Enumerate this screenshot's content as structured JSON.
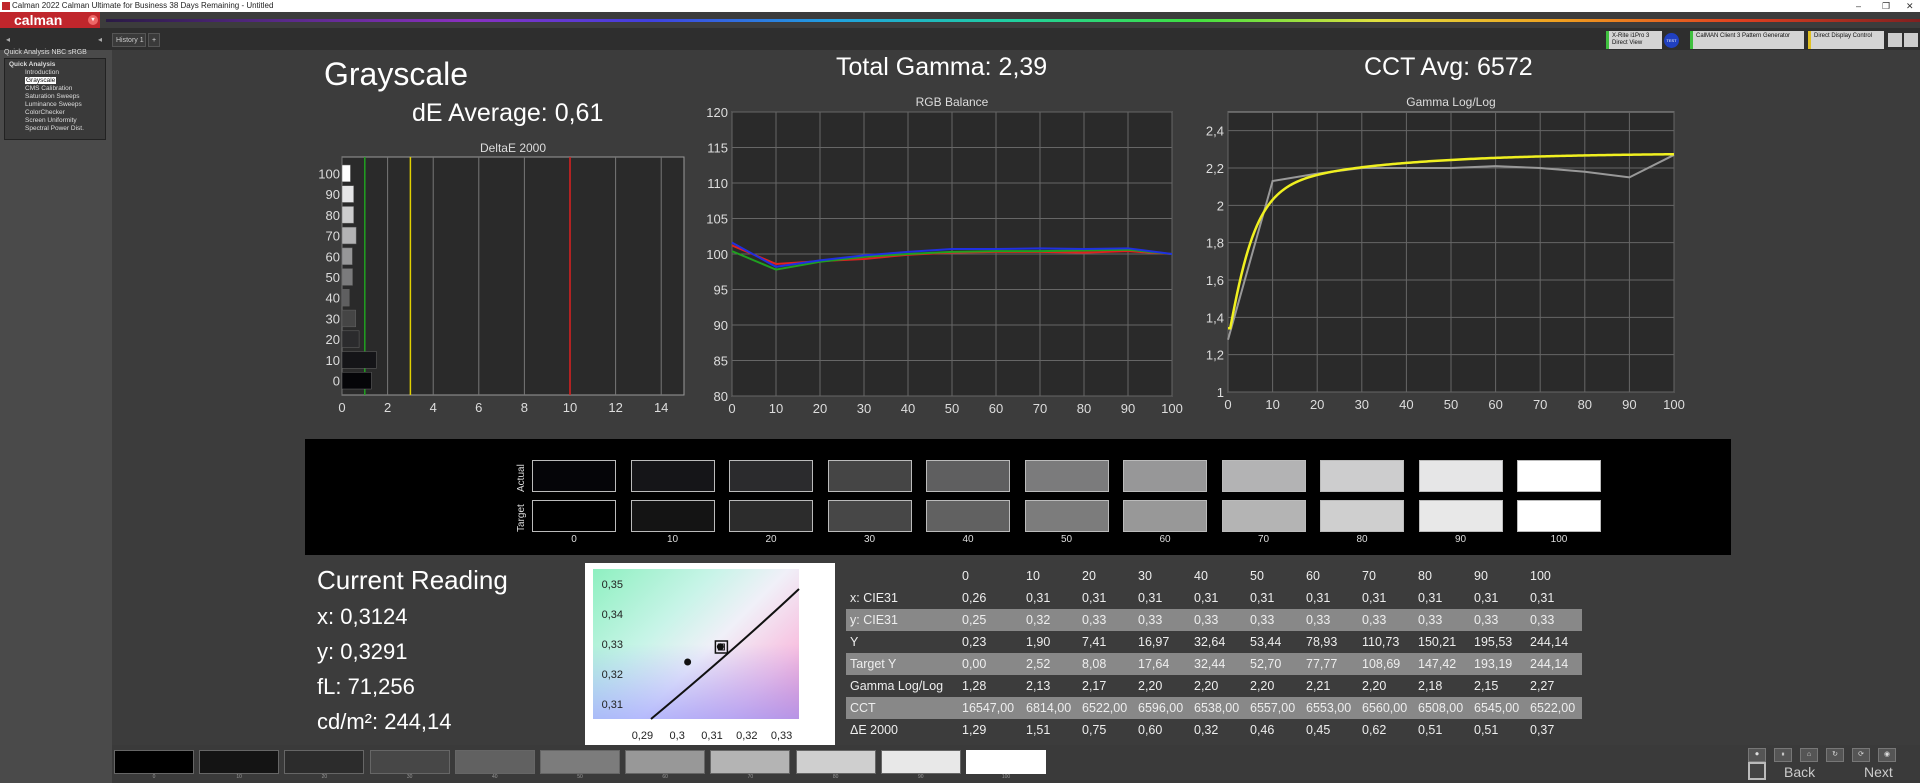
{
  "window": {
    "title": "Calman 2022 Calman Ultimate for Business 38 Days Remaining  - Untitled",
    "minimize": "–",
    "maximize": "❐",
    "close": "✕"
  },
  "brand": {
    "logo_text": "calman",
    "menu_glyph": "▾"
  },
  "tab": {
    "label": "History 1",
    "add": "+"
  },
  "devices": [
    {
      "line1": "X-Rite i1Pro 3",
      "line2": "Direct View",
      "accent": "#40c040"
    },
    {
      "line1": "CalMAN Client 3 Pattern Generator",
      "line2": "",
      "accent": "#40c040"
    },
    {
      "line1": "Direct Display Control",
      "line2": "",
      "accent": "#e0c020"
    }
  ],
  "device_badge": "TEST",
  "sidebar": {
    "title": "Quick Analysis NBC sRGB",
    "items": [
      {
        "label": "Quick Analysis",
        "selected": false,
        "level": 0
      },
      {
        "label": "Introduction",
        "selected": false,
        "level": 1
      },
      {
        "label": "Grayscale",
        "selected": true,
        "level": 1
      },
      {
        "label": "CMS Calibration",
        "selected": false,
        "level": 1
      },
      {
        "label": "Saturation Sweeps",
        "selected": false,
        "level": 1
      },
      {
        "label": "Luminance Sweeps",
        "selected": false,
        "level": 1
      },
      {
        "label": "ColorChecker",
        "selected": false,
        "level": 1
      },
      {
        "label": "Screen Uniformity",
        "selected": false,
        "level": 1
      },
      {
        "label": "Spectral Power Dist.",
        "selected": false,
        "level": 1
      }
    ]
  },
  "header": {
    "page_title": "Grayscale",
    "de_average": "dE Average: 0,61",
    "total_gamma": "Total Gamma: 2,39",
    "cct_avg": "CCT Avg: 6572"
  },
  "chart_data": [
    {
      "type": "bar",
      "title": "DeltaE 2000",
      "orientation": "horizontal",
      "categories": [
        "0",
        "10",
        "20",
        "30",
        "40",
        "50",
        "60",
        "70",
        "80",
        "90",
        "100"
      ],
      "values": [
        1.29,
        1.51,
        0.75,
        0.6,
        0.32,
        0.46,
        0.45,
        0.62,
        0.51,
        0.51,
        0.37
      ],
      "xlim": [
        0,
        15
      ],
      "xticks": [
        "0",
        "2",
        "4",
        "6",
        "8",
        "10",
        "12",
        "14"
      ],
      "threshold_lines": [
        {
          "value": 1,
          "color": "#20a020"
        },
        {
          "value": 3,
          "color": "#e0d000"
        },
        {
          "value": 10,
          "color": "#e02020"
        }
      ]
    },
    {
      "type": "line",
      "title": "RGB Balance",
      "x": [
        0,
        10,
        20,
        30,
        40,
        50,
        60,
        70,
        80,
        90,
        100
      ],
      "ylim": [
        80,
        120
      ],
      "yticks": [
        "80",
        "85",
        "90",
        "95",
        "100",
        "105",
        "110",
        "115",
        "120"
      ],
      "xticks": [
        "0",
        "10",
        "20",
        "30",
        "40",
        "50",
        "60",
        "70",
        "80",
        "90",
        "100"
      ],
      "series": [
        {
          "color": "#e02020",
          "values": [
            101.2,
            98.6,
            99.0,
            99.3,
            99.9,
            100.2,
            100.3,
            100.3,
            100.2,
            100.4,
            100.0
          ]
        },
        {
          "color": "#20a020",
          "values": [
            100.4,
            97.8,
            98.9,
            99.6,
            100.0,
            100.3,
            100.4,
            100.4,
            100.5,
            100.6,
            100.0
          ]
        },
        {
          "color": "#2030e0",
          "values": [
            101.6,
            98.2,
            99.1,
            99.8,
            100.3,
            100.7,
            100.7,
            100.8,
            100.7,
            100.8,
            100.0
          ]
        }
      ]
    },
    {
      "type": "line",
      "title": "Gamma Log/Log",
      "x": [
        0,
        10,
        20,
        30,
        40,
        50,
        60,
        70,
        80,
        90,
        100
      ],
      "ylim": [
        1,
        2.5
      ],
      "yticks": [
        "1",
        "1,2",
        "1,4",
        "1,6",
        "1,8",
        "2",
        "2,2",
        "2,4"
      ],
      "xticks": [
        "0",
        "10",
        "20",
        "30",
        "40",
        "50",
        "60",
        "70",
        "80",
        "90",
        "100"
      ],
      "series": [
        {
          "color": "#999999",
          "values": [
            1.28,
            2.13,
            2.17,
            2.2,
            2.2,
            2.2,
            2.21,
            2.2,
            2.18,
            2.15,
            2.27
          ]
        },
        {
          "color": "#f0f020",
          "curve": "target",
          "gamma_target": 2.28
        }
      ]
    },
    {
      "type": "scatter",
      "title": "",
      "xlim": [
        0.285,
        0.335
      ],
      "ylim": [
        0.305,
        0.355
      ],
      "xticks": [
        "0,29",
        "0,3",
        "0,31",
        "0,32",
        "0,33"
      ],
      "yticks": [
        "0,31",
        "0,32",
        "0,33",
        "0,34",
        "0,35"
      ],
      "points": [
        {
          "x": 0.303,
          "y": 0.324
        },
        {
          "x": 0.3124,
          "y": 0.3291
        }
      ],
      "target": {
        "x": 0.3127,
        "y": 0.329
      }
    }
  ],
  "swatches": {
    "actual_label": "Actual",
    "target_label": "Target",
    "labels": [
      "0",
      "10",
      "20",
      "30",
      "40",
      "50",
      "60",
      "70",
      "80",
      "90",
      "100"
    ],
    "actual_colors": [
      "#050508",
      "#151518",
      "#2b2b2d",
      "#454545",
      "#5f5f60",
      "#7b7b7c",
      "#979798",
      "#b3b3b4",
      "#cdcdce",
      "#e6e6e7",
      "#ffffff"
    ],
    "target_colors": [
      "#000000",
      "#141414",
      "#2c2c2c",
      "#474747",
      "#616161",
      "#7c7c7c",
      "#989898",
      "#b4b4b4",
      "#cfcfcf",
      "#e8e8e8",
      "#ffffff"
    ]
  },
  "current_reading": {
    "title": "Current Reading",
    "x": "x: 0,3124",
    "y": "y: 0,3291",
    "fl": "fL: 71,256",
    "cdm2": "cd/m²: 244,14"
  },
  "table": {
    "headers": [
      "",
      "0",
      "10",
      "20",
      "30",
      "40",
      "50",
      "60",
      "70",
      "80",
      "90",
      "100"
    ],
    "rows": [
      {
        "label": "x: CIE31",
        "values": [
          "0,26",
          "0,31",
          "0,31",
          "0,31",
          "0,31",
          "0,31",
          "0,31",
          "0,31",
          "0,31",
          "0,31",
          "0,31"
        ]
      },
      {
        "label": "y: CIE31",
        "values": [
          "0,25",
          "0,32",
          "0,33",
          "0,33",
          "0,33",
          "0,33",
          "0,33",
          "0,33",
          "0,33",
          "0,33",
          "0,33"
        ]
      },
      {
        "label": "Y",
        "values": [
          "0,23",
          "1,90",
          "7,41",
          "16,97",
          "32,64",
          "53,44",
          "78,93",
          "110,73",
          "150,21",
          "195,53",
          "244,14"
        ]
      },
      {
        "label": "Target Y",
        "values": [
          "0,00",
          "2,52",
          "8,08",
          "17,64",
          "32,44",
          "52,70",
          "77,77",
          "108,69",
          "147,42",
          "193,19",
          "244,14"
        ]
      },
      {
        "label": "Gamma Log/Log",
        "values": [
          "1,28",
          "2,13",
          "2,17",
          "2,20",
          "2,20",
          "2,20",
          "2,21",
          "2,20",
          "2,18",
          "2,15",
          "2,27"
        ]
      },
      {
        "label": "CCT",
        "values": [
          "16547,00",
          "6814,00",
          "6522,00",
          "6596,00",
          "6538,00",
          "6557,00",
          "6553,00",
          "6560,00",
          "6508,00",
          "6545,00",
          "6522,00"
        ]
      },
      {
        "label": "ΔE 2000",
        "values": [
          "1,29",
          "1,51",
          "0,75",
          "0,60",
          "0,32",
          "0,46",
          "0,45",
          "0,62",
          "0,51",
          "0,51",
          "0,37"
        ]
      }
    ]
  },
  "bottom": {
    "labels": [
      "0",
      "10",
      "20",
      "30",
      "40",
      "50",
      "60",
      "70",
      "80",
      "90",
      "100"
    ],
    "colors": [
      "#000000",
      "#141414",
      "#2c2c2c",
      "#474747",
      "#616161",
      "#7c7c7c",
      "#989898",
      "#b4b4b4",
      "#cfcfcf",
      "#e8e8e8",
      "#ffffff"
    ],
    "back": "Back",
    "next": "Next"
  }
}
